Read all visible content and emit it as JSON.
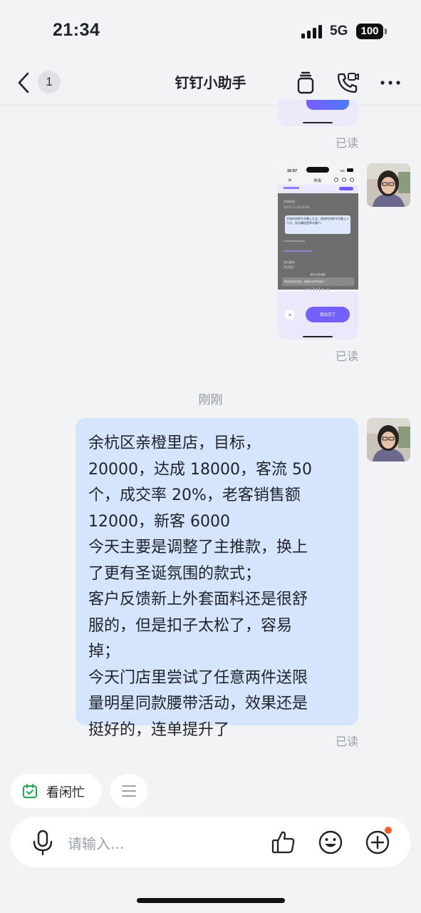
{
  "status_bar": {
    "time": "21:34",
    "network": "5G",
    "battery": "100"
  },
  "header": {
    "back_count": "1",
    "title": "钉钉小助手"
  },
  "messages": {
    "read_label": "已读",
    "timestamp": "刚刚",
    "text_lines": [
      "余杭区亲橙里店，目标，",
      "20000，达成 18000，客流 50",
      "个，成交率 20%，老客销售额",
      "12000，新客 6000",
      "今天主要是调整了主推款，换上",
      "了更有圣诞氛围的款式；",
      "客户反馈新上外套面料还是很舒",
      "服的，但是扣子太松了，容易",
      "掉；",
      "今天门店里尝试了任意两件送限",
      "量明星同款腰带活动，效果还是",
      "挺好的，连单提升了"
    ]
  },
  "screenshot_thumb": {
    "time": "15:57",
    "title": "外出",
    "network": "5G",
    "tooltip": "开始时间是今天晚上九点，结束时间是今天晚上十六点，外出事由是拜访客户。",
    "field_label": "开始时间",
    "field_value": "2025-11-26 09:00",
    "reason_label": "外出事由",
    "reason_value": "拜访客户",
    "listening": "我可以说话哦",
    "tip": "明天的拒外出后，嘴南东亚拜访客户。",
    "confirm": "我说完了"
  },
  "quick_chips": {
    "busy_label": "看闲忙"
  },
  "input": {
    "placeholder": "请输入..."
  },
  "colors": {
    "bubble": "#d5e5fe",
    "accent": "#6b5cff",
    "chip_icon": "#1aab4a",
    "notify_dot": "#ff5b2e"
  }
}
